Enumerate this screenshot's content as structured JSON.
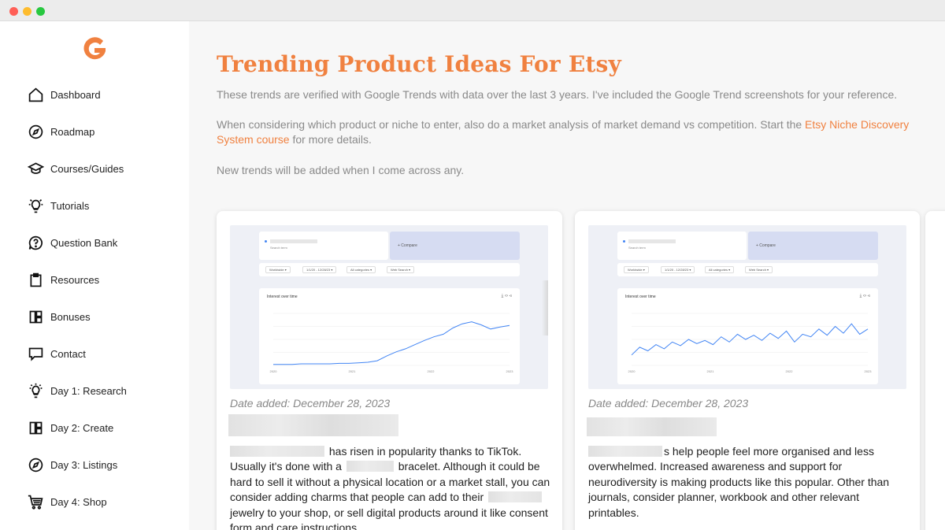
{
  "window": {
    "controls": [
      "close",
      "minimize",
      "maximize"
    ]
  },
  "brand": {
    "logo_icon": "g-logo-icon",
    "color": "#f08140"
  },
  "sidebar": {
    "items": [
      {
        "label": "Dashboard",
        "icon": "home-icon"
      },
      {
        "label": "Roadmap",
        "icon": "compass-icon"
      },
      {
        "label": "Courses/Guides",
        "icon": "graduation-cap-icon"
      },
      {
        "label": "Tutorials",
        "icon": "lightbulb-icon"
      },
      {
        "label": "Question Bank",
        "icon": "question-icon"
      },
      {
        "label": "Resources",
        "icon": "clipboard-icon"
      },
      {
        "label": "Bonuses",
        "icon": "layout-icon"
      },
      {
        "label": "Contact",
        "icon": "chat-icon"
      },
      {
        "label": "Day 1: Research",
        "icon": "lightbulb-head-icon"
      },
      {
        "label": "Day 2: Create",
        "icon": "layout-icon"
      },
      {
        "label": "Day 3: Listings",
        "icon": "compass-icon"
      },
      {
        "label": "Day 4: Shop",
        "icon": "cart-icon"
      }
    ]
  },
  "main": {
    "title": "Trending Product Ideas For Etsy",
    "intro_1": "These trends are verified with Google Trends with data over the last 3 years. I've included the Google Trend screenshots for your reference.",
    "intro_2_before": "When considering which product or niche to enter, also do a market analysis of market demand vs competition. Start the ",
    "intro_2_link": "Etsy Niche Discovery System course",
    "intro_2_after": " for more details.",
    "intro_3": "New trends will be added when I come across any."
  },
  "cards": [
    {
      "trend": {
        "search_placeholder": "Search term",
        "compare": "+   Compare",
        "filters": [
          "Worldwide ▾",
          "1/1/20 - 12/28/23 ▾",
          "All categories ▾",
          "Web Search ▾"
        ],
        "chart_title": "Interest over time",
        "chart_icons": "⤓  ‹›  ⋖"
      },
      "date": "Date added: December 28, 2023",
      "desc_1": " has risen in popularity thanks to TikTok. Usually it's done with a ",
      "desc_2": " bracelet. Although it could be hard to sell it without a physical location or a market stall, you can consider adding charms that people can add to their ",
      "desc_3": " jewelry to your shop, or sell digital products around it like consent form and care instructions."
    },
    {
      "trend": {
        "search_placeholder": "Search term",
        "compare": "+   Compare",
        "filters": [
          "Worldwide ▾",
          "1/1/20 - 12/28/23 ▾",
          "All categories ▾",
          "Web Search ▾"
        ],
        "chart_title": "Interest over time",
        "chart_icons": "⤓  ‹›  ⋖"
      },
      "date": "Date added: December 28, 2023",
      "desc_1": "s help people feel more organised and less overwhelmed. Increased awareness and support for neurodiversity is making products like this popular. Other than journals, consider planner, workbook and other relevant printables."
    }
  ],
  "chart_data": [
    {
      "type": "line",
      "title": "Interest over time",
      "x": [
        "2020",
        "2021",
        "2022",
        "2023"
      ],
      "series": [
        {
          "values": [
            2,
            2,
            2,
            3,
            3,
            3,
            3,
            4,
            4,
            5,
            6,
            9,
            18,
            26,
            32,
            40,
            48,
            55,
            60,
            72,
            80,
            84,
            78,
            70,
            74,
            77
          ]
        }
      ],
      "ylim": [
        0,
        100
      ]
    },
    {
      "type": "line",
      "title": "Interest over time",
      "x": [
        "2020",
        "2021",
        "2022",
        "2023"
      ],
      "series": [
        {
          "values": [
            20,
            35,
            28,
            40,
            32,
            45,
            38,
            50,
            42,
            48,
            40,
            55,
            45,
            60,
            50,
            58,
            48,
            62,
            52,
            66,
            45,
            60,
            55,
            70,
            58,
            75,
            62,
            80,
            60,
            70
          ]
        }
      ],
      "ylim": [
        0,
        100
      ]
    }
  ]
}
